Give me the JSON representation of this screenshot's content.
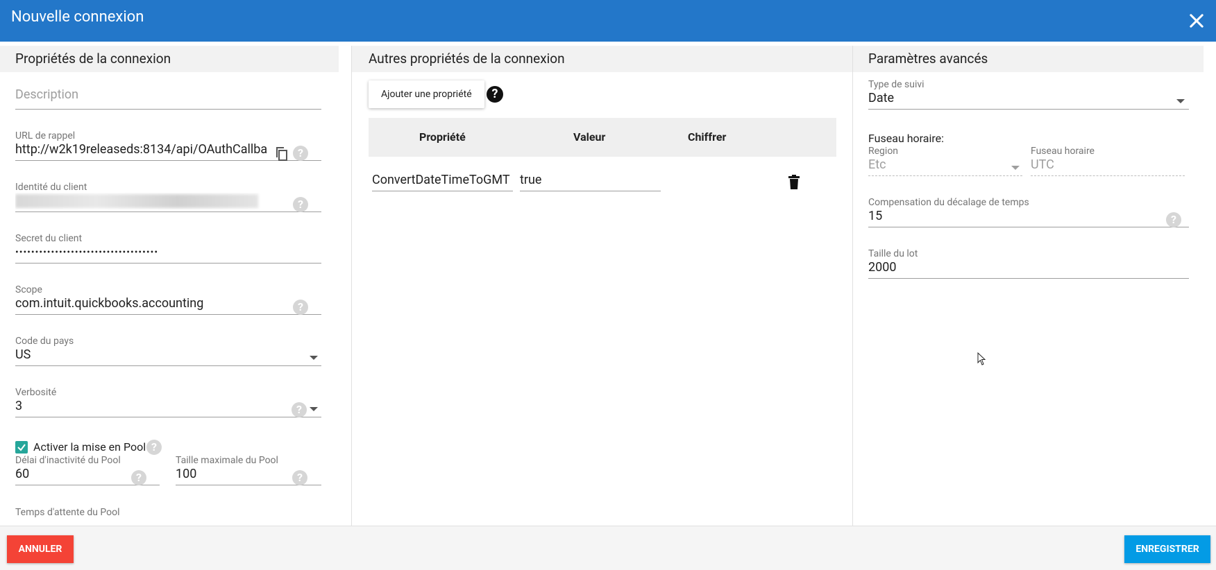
{
  "dialog": {
    "title": "Nouvelle connexion"
  },
  "connection": {
    "header": "Propriétés de la connexion",
    "description_placeholder": "Description",
    "callback_label": "URL de rappel",
    "callback_value": "http://w2k19releaseds:8134/api/OAuthCallba",
    "client_id_label": "Identité du client",
    "client_secret_label": "Secret du client",
    "client_secret_value": "••••••••••••••••••••••••••••••••••••",
    "scope_label": "Scope",
    "scope_value": "com.intuit.quickbooks.accounting",
    "country_label": "Code du pays",
    "country_value": "US",
    "verbosity_label": "Verbosité",
    "verbosity_value": "3",
    "pool_enable_label": "Activer la mise en Pool",
    "pool_idle_label": "Délai d'inactivité du Pool",
    "pool_idle_value": "60",
    "pool_max_label": "Taille maximale du Pool",
    "pool_max_value": "100",
    "pool_wait_label": "Temps d'attente du Pool"
  },
  "other": {
    "header": "Autres propriétés de la connexion",
    "add_button": "Ajouter une propriété",
    "columns": [
      "Propriété",
      "Valeur",
      "Chiffrer"
    ],
    "rows": [
      {
        "property": "ConvertDateTimeToGMT",
        "value": "true"
      }
    ]
  },
  "advanced": {
    "header": "Paramètres avancés",
    "tracking_label": "Type de suivi",
    "tracking_value": "Date",
    "timezone_title": "Fuseau horaire:",
    "region_label": "Region",
    "region_value": "Etc",
    "tz_label": "Fuseau horaire",
    "tz_value": "UTC",
    "offset_label": "Compensation du décalage de temps",
    "offset_value": "15",
    "batch_label": "Taille du lot",
    "batch_value": "2000"
  },
  "footer": {
    "cancel": "ANNULER",
    "save": "ENREGISTRER"
  },
  "icons": {
    "close": "close-icon",
    "copy": "copy-icon",
    "help": "help-icon",
    "trash": "trash-icon"
  },
  "colors": {
    "titlebar": "#2377c9",
    "cancel": "#f44336",
    "save": "#039be5",
    "checkbox": "#26a69a"
  }
}
